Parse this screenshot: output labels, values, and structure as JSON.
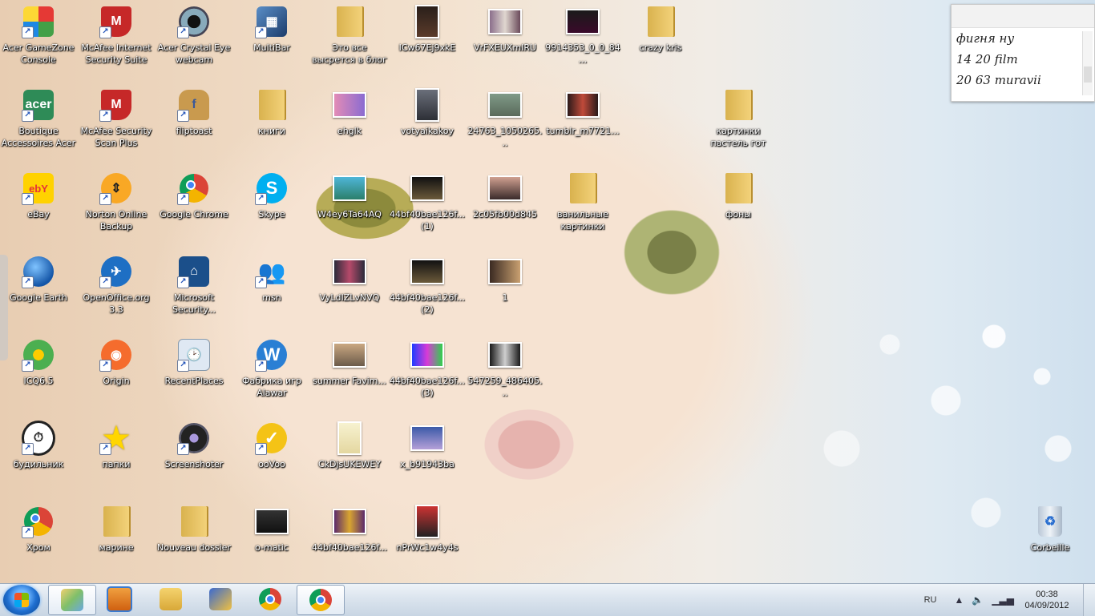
{
  "desktop": {
    "icons": [
      {
        "label": "Acer GameZone Console",
        "icon": "rubik-cube-icon",
        "shortcut": true
      },
      {
        "label": "McAfee Internet Security Suite",
        "icon": "mcafee-shield-icon",
        "shortcut": true
      },
      {
        "label": "Acer Crystal Eye webcam",
        "icon": "webcam-icon",
        "shortcut": true
      },
      {
        "label": "MultiBar",
        "icon": "multibar-icon",
        "shortcut": true
      },
      {
        "label": "Это все высрется в блог",
        "icon": "folder-icon",
        "shortcut": false
      },
      {
        "label": "ICw67Ej9xkE",
        "icon": "image-thumbnail-icon",
        "shortcut": false
      },
      {
        "label": "VrFXEUXmIRU",
        "icon": "image-thumbnail-icon",
        "shortcut": false
      },
      {
        "label": "9914353_0_0_84...",
        "icon": "image-thumbnail-icon",
        "shortcut": false
      },
      {
        "label": "crazy kris",
        "icon": "folder-icon",
        "shortcut": false
      },
      {
        "label": "Boutique Accessoires Acer",
        "icon": "acer-cart-icon",
        "shortcut": true
      },
      {
        "label": "McAfee Security Scan Plus",
        "icon": "mcafee-shield-icon",
        "shortcut": true
      },
      {
        "label": "fliptoast",
        "icon": "toast-icon",
        "shortcut": true
      },
      {
        "label": "книги",
        "icon": "folder-icon",
        "shortcut": false
      },
      {
        "label": "ehglk",
        "icon": "image-thumbnail-icon",
        "shortcut": false
      },
      {
        "label": "votyaikakoy",
        "icon": "image-thumbnail-icon",
        "shortcut": false
      },
      {
        "label": "24763_1050265...",
        "icon": "image-thumbnail-icon",
        "shortcut": false
      },
      {
        "label": "tumblr_m7721...",
        "icon": "image-thumbnail-icon",
        "shortcut": false
      },
      {
        "label": "картинки пастель гот",
        "icon": "folder-icon",
        "shortcut": false
      },
      {
        "label": "eBay",
        "icon": "ebay-icon",
        "shortcut": true
      },
      {
        "label": "Norton Online Backup",
        "icon": "norton-backup-icon",
        "shortcut": true
      },
      {
        "label": "Google Chrome",
        "icon": "chrome-icon",
        "shortcut": true
      },
      {
        "label": "Skype",
        "icon": "skype-icon",
        "shortcut": true
      },
      {
        "label": "W4ey6Ta64AQ",
        "icon": "image-thumbnail-icon",
        "shortcut": false
      },
      {
        "label": "44bf40bae126f... (1)",
        "icon": "image-thumbnail-icon",
        "shortcut": false
      },
      {
        "label": "2c05fb00d845",
        "icon": "image-thumbnail-icon",
        "shortcut": false
      },
      {
        "label": "ванильные картинки",
        "icon": "folder-icon",
        "shortcut": false
      },
      {
        "label": "фоны",
        "icon": "folder-icon",
        "shortcut": false
      },
      {
        "label": "Google Earth",
        "icon": "google-earth-icon",
        "shortcut": true
      },
      {
        "label": "OpenOffice.org 3.3",
        "icon": "openoffice-icon",
        "shortcut": true
      },
      {
        "label": "Microsoft Security...",
        "icon": "microsoft-security-icon",
        "shortcut": true
      },
      {
        "label": "msn",
        "icon": "msn-icon",
        "shortcut": true
      },
      {
        "label": "VyLdIZLvNVQ",
        "icon": "image-thumbnail-icon",
        "shortcut": false
      },
      {
        "label": "44bf40bae126f... (2)",
        "icon": "image-thumbnail-icon",
        "shortcut": false
      },
      {
        "label": "1",
        "icon": "image-thumbnail-icon",
        "shortcut": false
      },
      {
        "label": "ICQ6.5",
        "icon": "icq-flower-icon",
        "shortcut": true
      },
      {
        "label": "Origin",
        "icon": "origin-icon",
        "shortcut": true
      },
      {
        "label": "RecentPlaces",
        "icon": "recent-places-icon",
        "shortcut": true
      },
      {
        "label": "Фабрика игр Alawar",
        "icon": "alawar-icon",
        "shortcut": true
      },
      {
        "label": "summer Favim...",
        "icon": "image-thumbnail-icon",
        "shortcut": false
      },
      {
        "label": "44bf40bae126f... (3)",
        "icon": "image-thumbnail-icon",
        "shortcut": false
      },
      {
        "label": "547259_486405...",
        "icon": "image-thumbnail-icon",
        "shortcut": false
      },
      {
        "label": "будильник",
        "icon": "alarm-clock-icon",
        "shortcut": true
      },
      {
        "label": "папки",
        "icon": "star-icon",
        "shortcut": true
      },
      {
        "label": "Screenshoter",
        "icon": "camera-lens-icon",
        "shortcut": true
      },
      {
        "label": "ooVoo",
        "icon": "oovoo-icon",
        "shortcut": true
      },
      {
        "label": "CkDjsUKEWEY",
        "icon": "image-thumbnail-icon",
        "shortcut": false
      },
      {
        "label": "x_b91943ba",
        "icon": "image-thumbnail-icon",
        "shortcut": false
      },
      {
        "label": "Хром",
        "icon": "chrome-icon",
        "shortcut": true
      },
      {
        "label": "марине",
        "icon": "folder-icon",
        "shortcut": false
      },
      {
        "label": "Nouveau dossier",
        "icon": "folder-icon",
        "shortcut": false
      },
      {
        "label": "o-matic",
        "icon": "image-thumbnail-icon",
        "shortcut": false
      },
      {
        "label": "44bf40bae126f...",
        "icon": "image-thumbnail-icon",
        "shortcut": false
      },
      {
        "label": "nPrWc1w4y4s",
        "icon": "image-thumbnail-icon",
        "shortcut": false
      },
      {
        "label": "Corbeille",
        "icon": "recycle-bin-icon",
        "shortcut": false
      }
    ]
  },
  "notes_gadget": {
    "lines": [
      "фигня ну",
      "14 20 film",
      "20 63 muravii"
    ]
  },
  "taskbar": {
    "pinned": [
      {
        "icon": "windows-explorer-libraries-icon",
        "active": true
      },
      {
        "icon": "media-player-icon",
        "active": false
      },
      {
        "icon": "file-explorer-icon",
        "active": false
      },
      {
        "icon": "pen-tool-icon",
        "active": false
      },
      {
        "icon": "chrome-icon",
        "active": false
      },
      {
        "icon": "chrome-icon",
        "active": true
      }
    ],
    "tray": {
      "language": "RU",
      "time": "00:38",
      "date": "04/09/2012"
    }
  }
}
